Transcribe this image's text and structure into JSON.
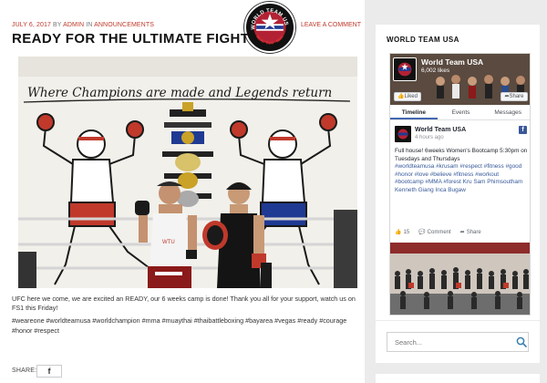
{
  "post": {
    "date": "JULY 6, 2017",
    "by": "BY",
    "author": "ADMIN",
    "in": "IN",
    "category": "ANNOUNCEMENTS",
    "leave_comment": "LEAVE A COMMENT",
    "title": "READY FOR THE ULTIMATE FIGHT",
    "body": "UFC here we come, we are excited an READY, our 6 weeks camp is done! Thank you all for your support, watch us on FS1 this Friday!",
    "tags_line1": "#weareone #worldteamusa #worldchampion #mma #muaythai #thaibattleboxing #bayarea #vegas #ready #courage",
    "tags_line2": "#honor #respect",
    "share_label": "SHARE:",
    "share_facebook": "f"
  },
  "logo": {
    "top_text": "WORLD TEAM USA",
    "bottom_text": "MUAY THAI · MMA"
  },
  "photo": {
    "wall_slogan": "Where Champions are made and Legends return"
  },
  "sidebar": {
    "widget_title": "WORLD TEAM USA",
    "fb": {
      "page_name": "World Team USA",
      "likes": "6,002 likes",
      "liked_button": "Liked",
      "share_button": "Share",
      "tabs": [
        "Timeline",
        "Events",
        "Messages"
      ],
      "post_author": "World Team USA",
      "post_time": "4 hours ago",
      "post_text_1": "Full house! 6weeks Women's Bootcamp 5:30pm on Tuesdays and Thursdays",
      "post_tags": "#worldteamusa #krusam #respect #fitness #good #honor #love #believe #fitness #workout #bootcamp #MMA #forest Kru Sam Phimsoutham Kenneth Giang Inca Bugaw",
      "like_count": "15",
      "comment_label": "Comment",
      "share_label": "Share",
      "fb_icon_glyph": "f"
    },
    "search": {
      "placeholder": "Search..."
    }
  },
  "colors": {
    "accent_red": "#c0392b",
    "facebook_blue": "#3b5998",
    "search_icon": "#3a7fb0"
  }
}
